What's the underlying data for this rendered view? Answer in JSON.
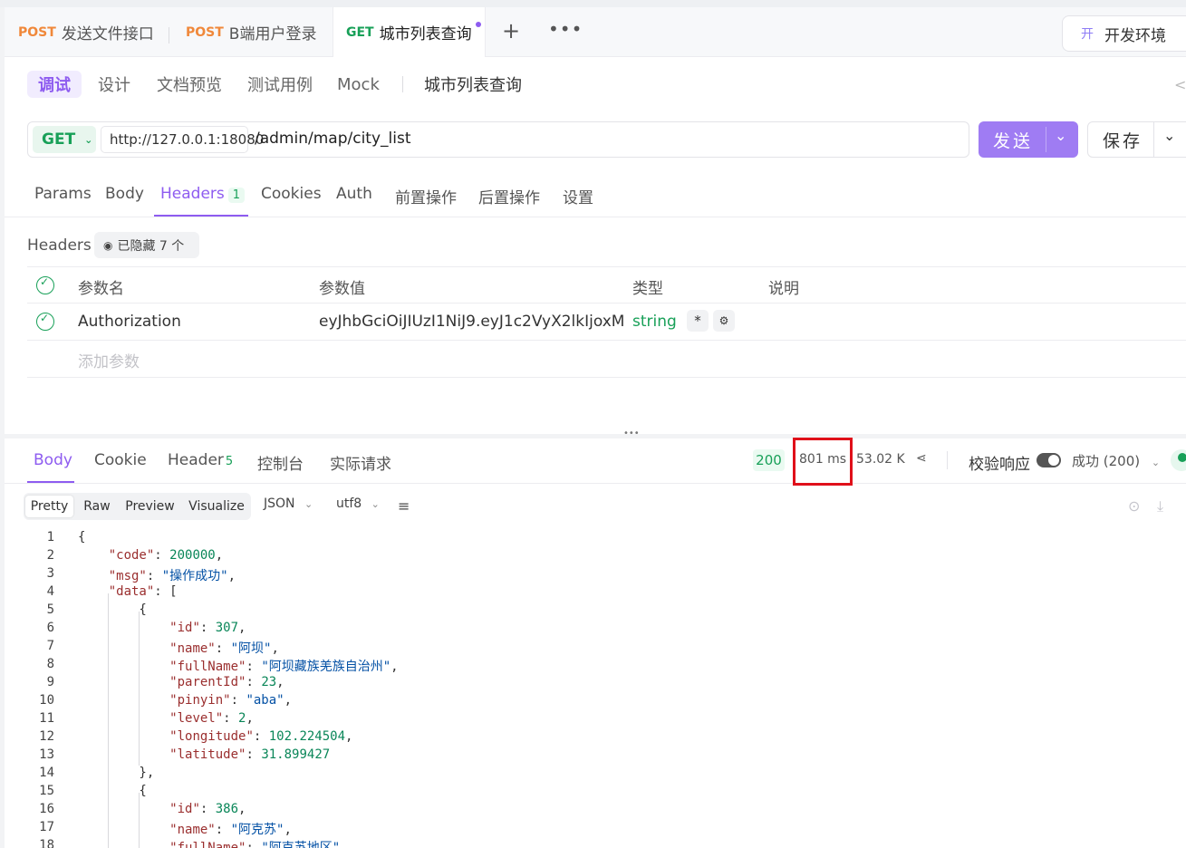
{
  "tabs": [
    {
      "method": "POST",
      "title": "发送文件接口"
    },
    {
      "method": "POST",
      "title": "B端用户登录"
    },
    {
      "method": "GET",
      "title": "城市列表查询"
    }
  ],
  "env": {
    "badge": "开",
    "name": "开发环境"
  },
  "subtabs": [
    "调试",
    "设计",
    "文档预览",
    "测试用例",
    "Mock"
  ],
  "api_name": "城市列表查询",
  "request": {
    "method": "GET",
    "host": "http://127.0.0.1:18080",
    "path": "/admin/map/city_list",
    "send_label": "发送",
    "save_label": "保存"
  },
  "req_tabs": [
    "Params",
    "Body",
    "Headers",
    "Cookies",
    "Auth",
    "前置操作",
    "后置操作",
    "设置"
  ],
  "headers_count": "1",
  "headers_section": {
    "label": "Headers",
    "hidden_text": "已隐藏 7 个"
  },
  "table": {
    "cols": [
      "参数名",
      "参数值",
      "类型",
      "说明"
    ],
    "row": {
      "name": "Authorization",
      "value": "eyJhbGciOiJIUzI1NiJ9.eyJ1c2VyX2lkIjoxM",
      "type": "string",
      "required": "*"
    },
    "add_placeholder": "添加参数"
  },
  "response": {
    "tabs": [
      "Body",
      "Cookie",
      "Header",
      "控制台",
      "实际请求"
    ],
    "header_count": "5",
    "status": "200",
    "time": "801 ms",
    "size": "53.02 K",
    "verify_label": "校验响应",
    "result": "成功 (200)",
    "formats": [
      "Pretty",
      "Raw",
      "Preview",
      "Visualize"
    ],
    "lang": "JSON",
    "encoding": "utf8"
  },
  "code_lines": [
    "{",
    "    \"code\": 200000,",
    "    \"msg\": \"操作成功\",",
    "    \"data\": [",
    "        {",
    "            \"id\": 307,",
    "            \"name\": \"阿坝\",",
    "            \"fullName\": \"阿坝藏族羌族自治州\",",
    "            \"parentId\": 23,",
    "            \"pinyin\": \"aba\",",
    "            \"level\": 2,",
    "            \"longitude\": 102.224504,",
    "            \"latitude\": 31.899427",
    "        },",
    "        {",
    "            \"id\": 386,",
    "            \"name\": \"阿克苏\",",
    "            \"fullName\": \"阿克苏地区\""
  ]
}
